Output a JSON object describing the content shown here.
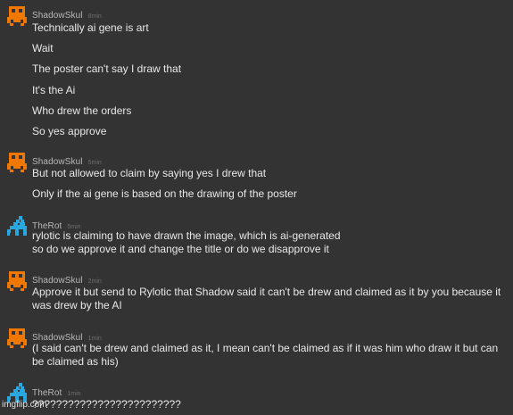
{
  "messages": [
    {
      "user": "ShadowSkul",
      "time": "8min",
      "avatar": "orange-skull-icon",
      "lines": [
        "Technically ai gene is art",
        "Wait",
        "The poster can't say I draw that",
        "It's the Ai",
        "Who drew the orders",
        "So yes approve"
      ]
    },
    {
      "user": "ShadowSkul",
      "time": "5min",
      "avatar": "orange-skull-icon",
      "lines": [
        "But not allowed to claim by saying yes I drew that",
        "Only if the ai gene is based on the drawing of the poster"
      ]
    },
    {
      "user": "TheRot",
      "time": "5min",
      "avatar": "blue-creature-icon",
      "lines": [
        "rylotic is claiming to have drawn the image, which is ai-generated",
        "so do we approve it and change the title or do we disapprove it"
      ]
    },
    {
      "user": "ShadowSkul",
      "time": "2min",
      "avatar": "orange-skull-icon",
      "lines": [
        "Approve it but send to Rylotic that Shadow said it can't be drew and claimed as it by you because it was drew by the AI"
      ]
    },
    {
      "user": "ShadowSkul",
      "time": "1min",
      "avatar": "orange-skull-icon",
      "lines": [
        "(I said can't be drew and claimed as it, I mean can't be claimed as if it was him who draw it but can be claimed as his)"
      ]
    },
    {
      "user": "TheRot",
      "time": "1min",
      "avatar": "blue-creature-icon",
      "lines": [
        "?????????????????????????"
      ]
    }
  ],
  "watermark": "imgflip.com",
  "colors": {
    "background": "#333333",
    "skull_orange": "#f07800",
    "creature_blue": "#29a7e0",
    "username": "#b8b8b8",
    "timestamp": "#6e6e6e",
    "text": "#e8e8e8"
  }
}
